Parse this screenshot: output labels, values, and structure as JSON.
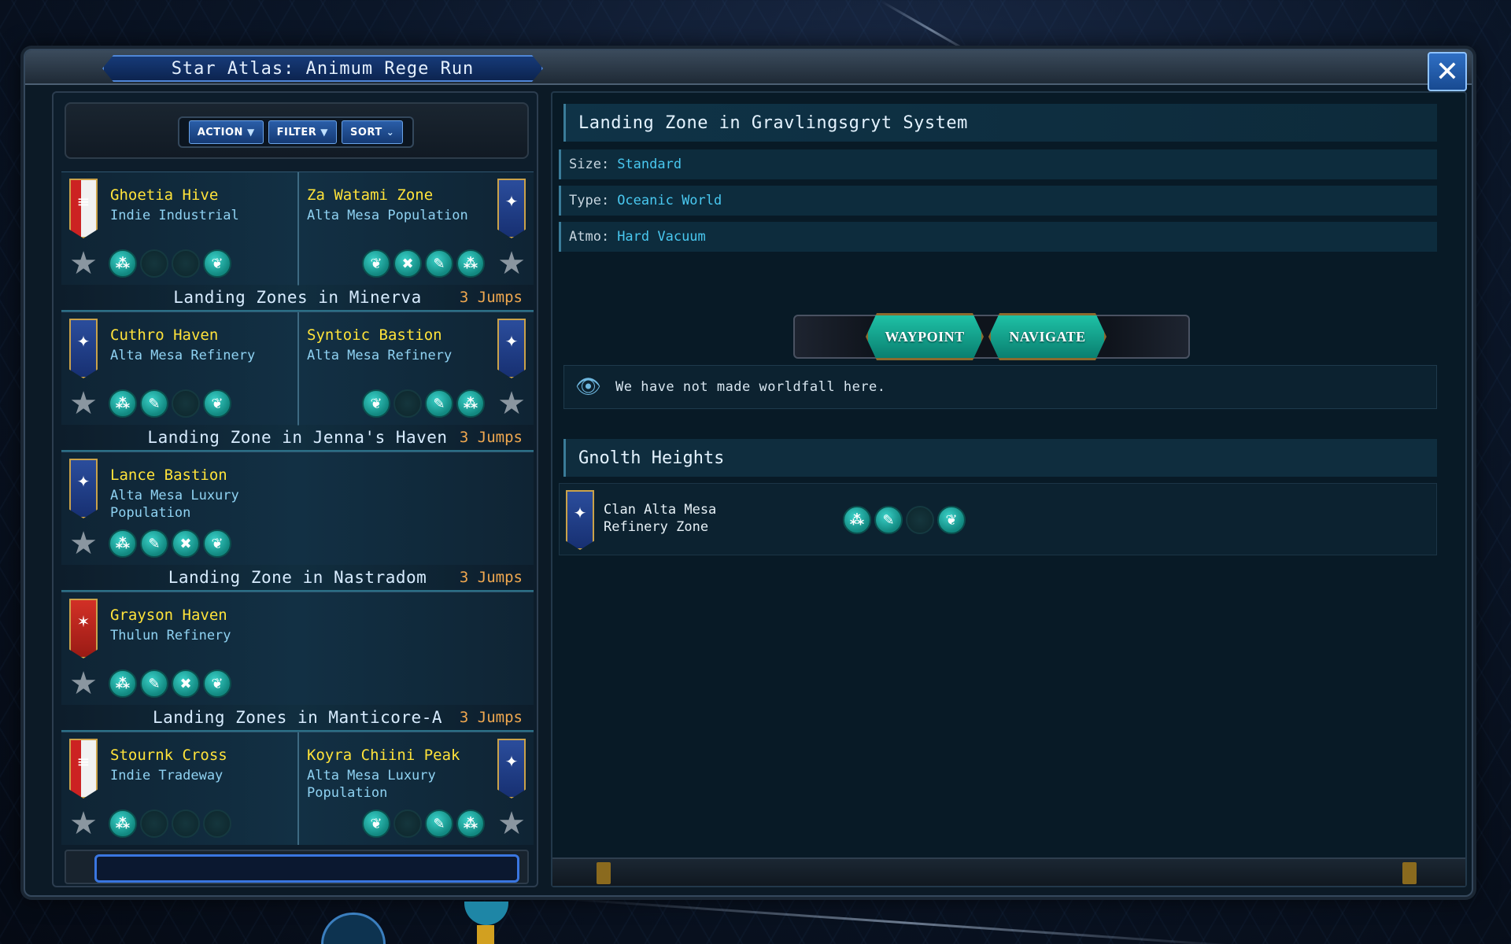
{
  "window": {
    "title": "Star Atlas: Animum Rege Run",
    "close_icon": "close-icon",
    "collapse_icon": "double-chevron-left-icon"
  },
  "toolbar": {
    "action_label": "ACTION",
    "filter_label": "FILTER",
    "sort_label": "SORT"
  },
  "zones": [
    {
      "header": null,
      "left": {
        "name": "Ghoetia Hive",
        "sub": "Indie Industrial",
        "banner": "redwhite",
        "icons": [
          "atom",
          "empty",
          "empty",
          "leaf"
        ]
      },
      "right": {
        "name": "Za Watami Zone",
        "sub": "Alta Mesa Population",
        "banner": "blue",
        "icons": [
          "leaf",
          "tool",
          "wrench",
          "atom"
        ]
      }
    },
    {
      "header": {
        "title": "Landing Zones in Minerva",
        "jumps": "3 Jumps"
      },
      "left": {
        "name": "Cuthro Haven",
        "sub": "Alta Mesa Refinery",
        "banner": "blue",
        "icons": [
          "atom",
          "wrench",
          "empty",
          "leaf"
        ]
      },
      "right": {
        "name": "Syntoic Bastion",
        "sub": "Alta Mesa Refinery",
        "banner": "blue",
        "icons": [
          "leaf",
          "empty",
          "wrench",
          "atom"
        ]
      }
    },
    {
      "header": {
        "title": "Landing Zone in Jenna's Haven",
        "jumps": "3 Jumps"
      },
      "left": {
        "name": "Lance Bastion",
        "sub": "Alta Mesa Luxury Population",
        "banner": "blue",
        "icons": [
          "atom",
          "wrench",
          "tool",
          "leaf"
        ]
      },
      "right": null
    },
    {
      "header": {
        "title": "Landing Zone in Nastradom",
        "jumps": "3 Jumps"
      },
      "left": {
        "name": "Grayson Haven",
        "sub": "Thulun Refinery",
        "banner": "red",
        "icons": [
          "atom",
          "wrench",
          "tool",
          "leaf"
        ]
      },
      "right": null
    },
    {
      "header": {
        "title": "Landing Zones in Manticore-A",
        "jumps": "3 Jumps"
      },
      "left": {
        "name": "Stournk Cross",
        "sub": "Indie Tradeway",
        "banner": "redwhite",
        "icons": [
          "atom",
          "empty",
          "empty",
          "empty"
        ]
      },
      "right": {
        "name": "Koyra Chiini Peak",
        "sub": "Alta Mesa Luxury Population",
        "banner": "blue",
        "icons": [
          "leaf",
          "empty",
          "wrench",
          "atom"
        ]
      }
    }
  ],
  "detail": {
    "title": "Landing Zone in Gravlingsgryt System",
    "size_label": "Size:",
    "size_value": "Standard",
    "type_label": "Type:",
    "type_value": "Oceanic World",
    "atmo_label": "Atmo:",
    "atmo_value": "Hard Vacuum",
    "waypoint_label": "WAYPOINT",
    "navigate_label": "NAVIGATE",
    "note": "We have not made worldfall here.",
    "section_title": "Gnolth Heights",
    "faction_name": "Clan Alta Mesa Refinery Zone",
    "faction_icons": [
      "atom",
      "wrench",
      "empty",
      "leaf"
    ]
  },
  "colors": {
    "zone_name": "#ffe33a",
    "zone_sub": "#8fd2f2",
    "jumps": "#f0a850",
    "value_text": "#49c8f0",
    "resource_icon": "#1fb7ad"
  }
}
